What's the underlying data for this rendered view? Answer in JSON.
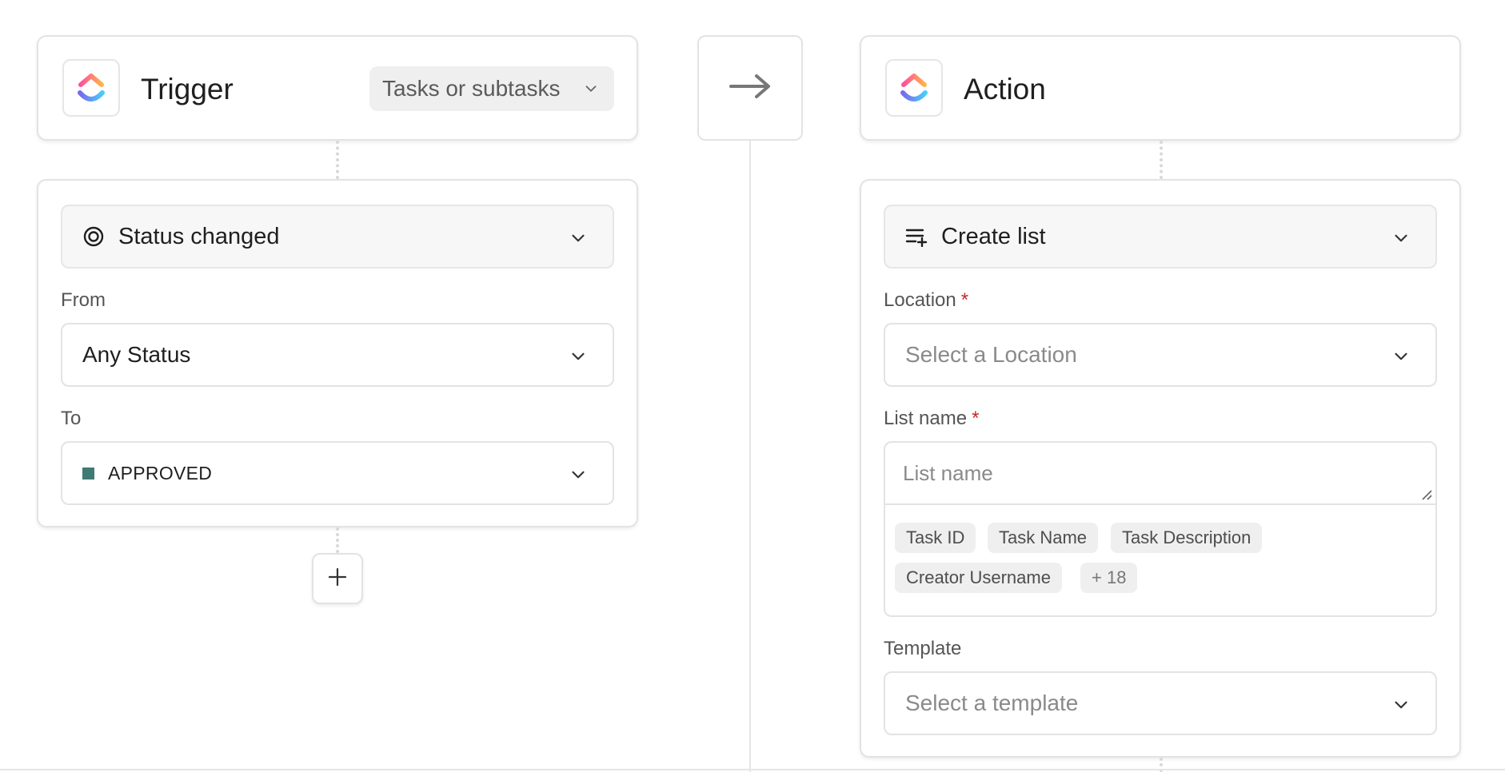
{
  "trigger": {
    "title": "Trigger",
    "scope": "Tasks or subtasks",
    "event": "Status changed",
    "from_label": "From",
    "from_value": "Any Status",
    "to_label": "To",
    "to_value": "APPROVED",
    "to_color": "#3f7a74"
  },
  "action": {
    "title": "Action",
    "type": "Create list",
    "location_label": "Location",
    "location_placeholder": "Select a Location",
    "list_name_label": "List name",
    "list_name_placeholder": "List name",
    "required_mark": "*",
    "variables": [
      "Task ID",
      "Task Name",
      "Task Description",
      "Creator Username"
    ],
    "more_variables": "+ 18",
    "template_label": "Template",
    "template_placeholder": "Select a template"
  },
  "colors": {
    "required": "#c62828",
    "logo_gradient": [
      "#ff4fa0",
      "#ffb34a",
      "#7b68ee",
      "#49ccf9"
    ]
  },
  "icons": {
    "logo": "clickup-logo-icon",
    "flow_arrow": "arrow-right-icon",
    "status_event": "target-icon",
    "create_list": "list-add-icon",
    "add_step": "plus-icon"
  }
}
